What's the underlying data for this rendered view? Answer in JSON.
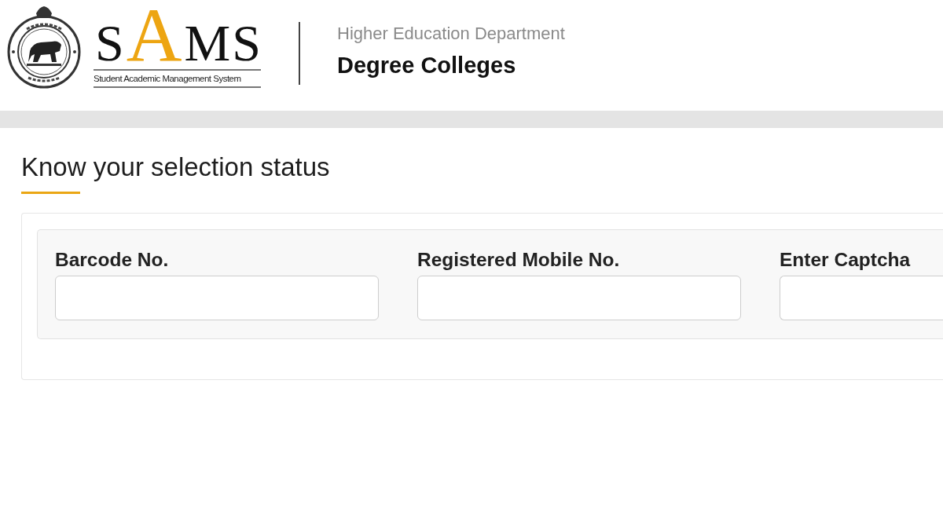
{
  "header": {
    "logo": {
      "letters": [
        {
          "text": "S",
          "accent": false
        },
        {
          "text": "A",
          "accent": true
        },
        {
          "text": "M",
          "accent": false
        },
        {
          "text": "S",
          "accent": false
        }
      ],
      "tagline": "Student Academic Management System"
    },
    "department": "Higher Education Department",
    "title": "Degree Colleges"
  },
  "page": {
    "heading": "Know your selection status",
    "form": {
      "fields": [
        {
          "label": "Barcode No."
        },
        {
          "label": "Registered Mobile No."
        },
        {
          "label": "Enter Captcha"
        }
      ]
    }
  }
}
